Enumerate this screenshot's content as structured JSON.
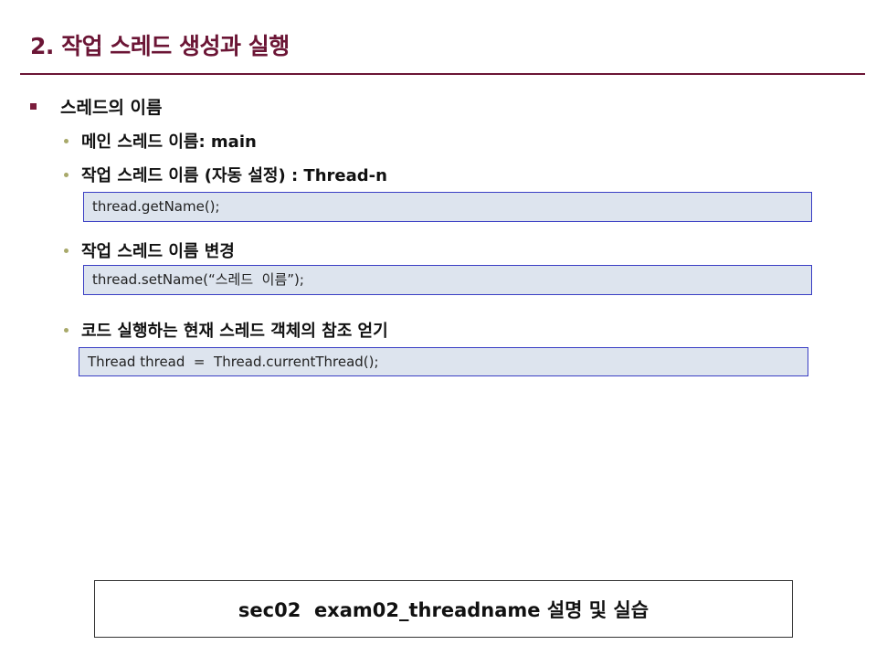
{
  "slide": {
    "title": "2. 작업 스레드 생성과 실행"
  },
  "bullet": {
    "label": "스레드의 이름"
  },
  "items": [
    {
      "label": "메인 스레드 이름: main"
    },
    {
      "label": "작업 스레드 이름 (자동 설정) : Thread-n",
      "code": "thread.getName();"
    },
    {
      "label": "작업 스레드 이름 변경",
      "code": "thread.setName(“스레드  이름”);"
    },
    {
      "label": "코드 실행하는 현재 스레드 객체의 참조 얻기",
      "code": "Thread thread  =  Thread.currentThread();"
    }
  ],
  "footer": {
    "label": "sec02  exam02_threadname 설명 및 실습"
  },
  "colors": {
    "title": "#6b1535",
    "code_bg": "#dde4ee",
    "code_border": "#3a3ec4",
    "sub_bullet": "#a8a96a"
  }
}
